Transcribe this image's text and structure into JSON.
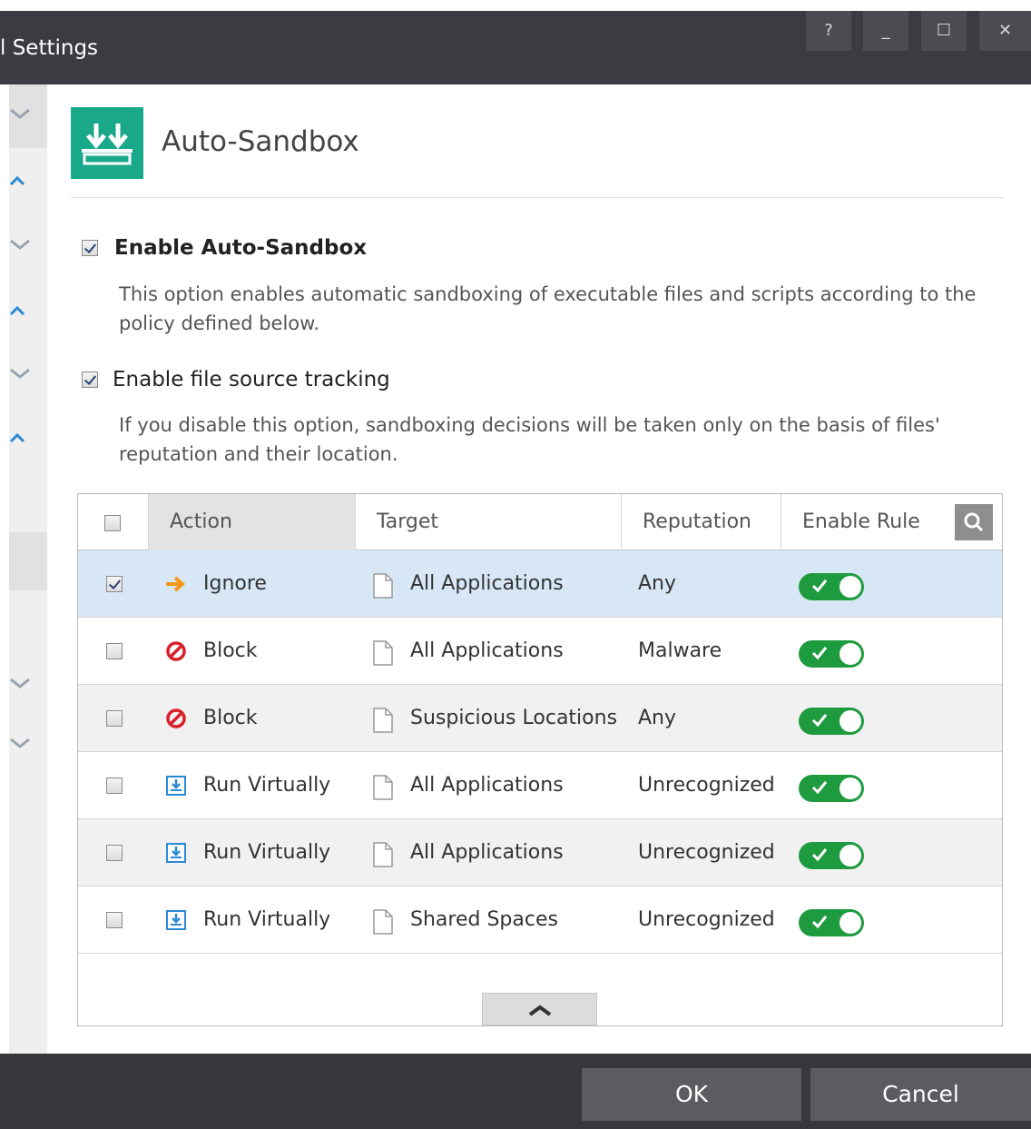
{
  "window": {
    "title": "l Settings",
    "buttons": {
      "help": "?",
      "minimize": "_",
      "maximize": "☐",
      "close": "✕"
    }
  },
  "header": {
    "title": "Auto-Sandbox",
    "icon": "sandbox-download-icon",
    "icon_color": "#1aa88a"
  },
  "options": {
    "enable_auto_sandbox": {
      "label": "Enable Auto-Sandbox",
      "checked": true,
      "description": "This option enables automatic sandboxing of executable files and scripts according to the policy defined below."
    },
    "enable_file_source_tracking": {
      "label": "Enable file source tracking",
      "checked": true,
      "description": "If you disable this option, sandboxing decisions will be taken only on the basis of files' reputation and their location."
    }
  },
  "table": {
    "columns": {
      "action": "Action",
      "target": "Target",
      "reputation": "Reputation",
      "enable_rule": "Enable Rule"
    },
    "rows": [
      {
        "checked": true,
        "action": "Ignore",
        "action_icon": "arrow-right-icon",
        "target": "All Applications",
        "reputation": "Any",
        "enabled": true
      },
      {
        "checked": false,
        "action": "Block",
        "action_icon": "block-icon",
        "target": "All Applications",
        "reputation": "Malware",
        "enabled": true
      },
      {
        "checked": false,
        "action": "Block",
        "action_icon": "block-icon",
        "target": "Suspicious Locations",
        "reputation": "Any",
        "enabled": true
      },
      {
        "checked": false,
        "action": "Run Virtually",
        "action_icon": "run-virtually-icon",
        "target": "All Applications",
        "reputation": "Unrecognized",
        "enabled": true
      },
      {
        "checked": false,
        "action": "Run Virtually",
        "action_icon": "run-virtually-icon",
        "target": "All Applications",
        "reputation": "Unrecognized",
        "enabled": true
      },
      {
        "checked": false,
        "action": "Run Virtually",
        "action_icon": "run-virtually-icon",
        "target": "Shared Spaces",
        "reputation": "Unrecognized",
        "enabled": true
      }
    ]
  },
  "footer": {
    "ok": "OK",
    "cancel": "Cancel"
  },
  "colors": {
    "accent": "#1aa88a",
    "toggle_on": "#1f9b3f",
    "block": "#d9202a",
    "ignore": "#f39a1b",
    "run_virtually": "#2a8ad4"
  }
}
